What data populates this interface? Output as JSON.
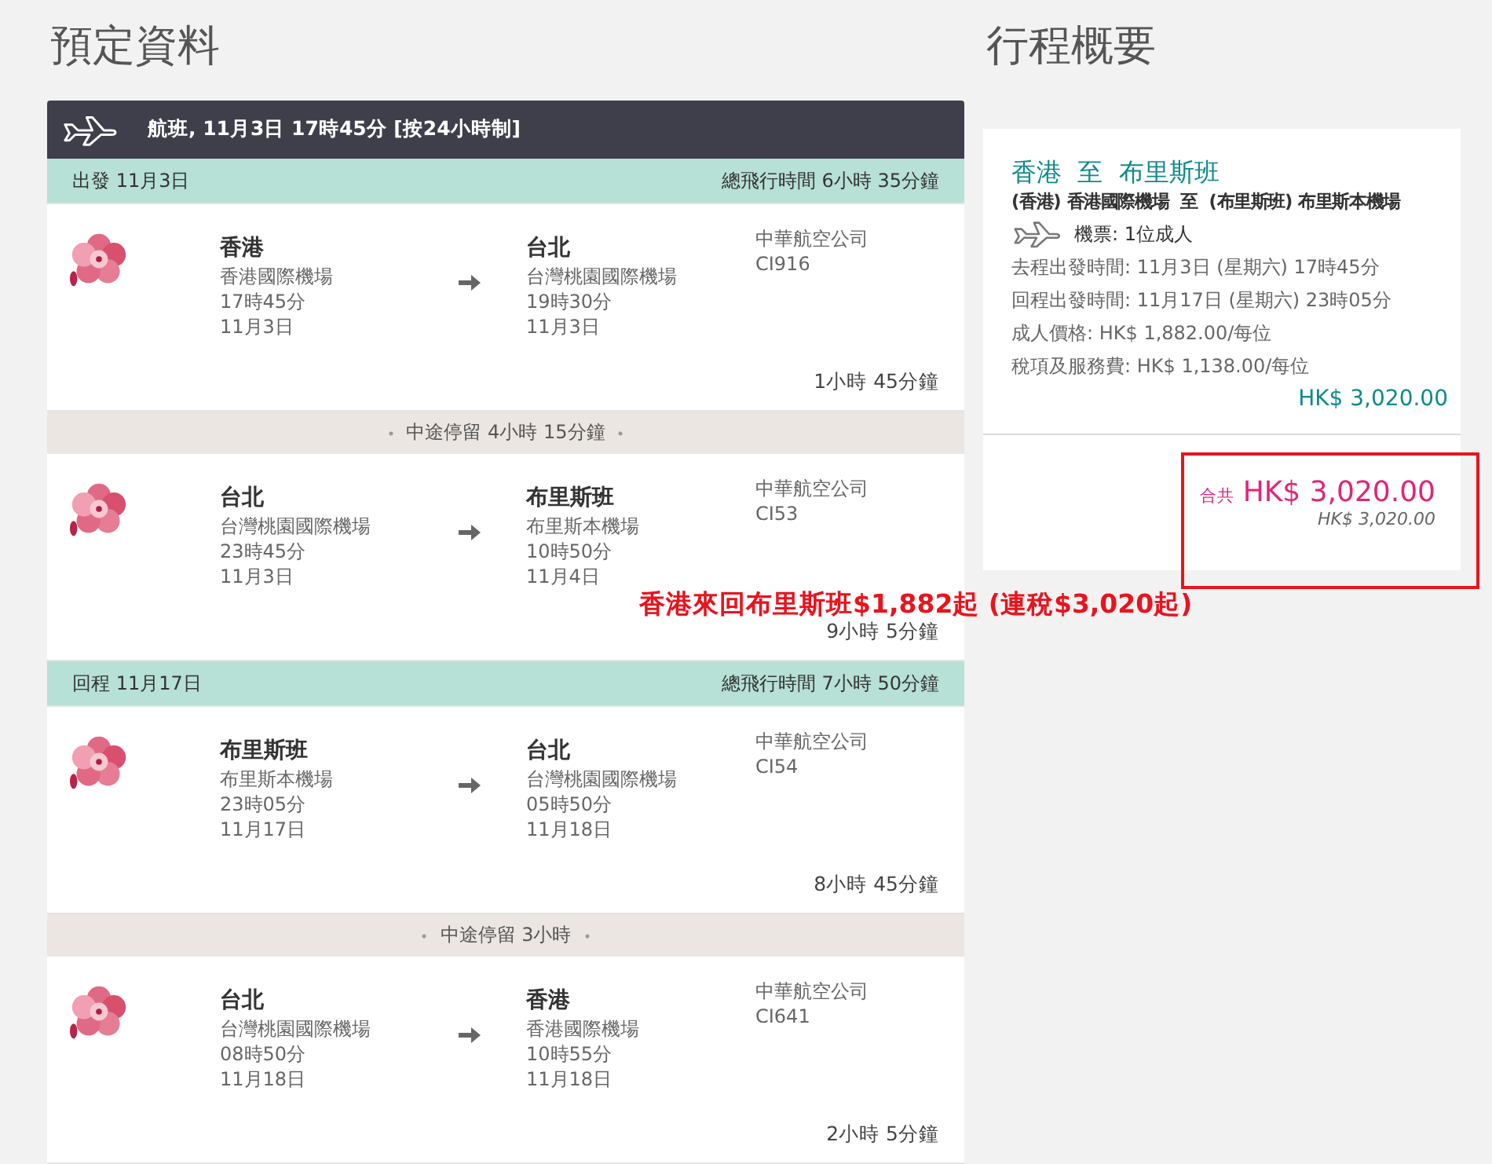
{
  "booking": {
    "title": "預定資料",
    "flight_header": "航班, 11月3日 17時45分 [按24小時制]",
    "sections": [
      {
        "kind": "leg",
        "label": "出發 11月3日",
        "total": "總飛行時間 6小時 35分鐘"
      },
      {
        "kind": "segment",
        "from_city": "香港",
        "from_airport": "香港國際機場",
        "from_time": "17時45分",
        "from_date": "11月3日",
        "to_city": "台北",
        "to_airport": "台灣桃園國際機場",
        "to_time": "19時30分",
        "to_date": "11月3日",
        "airline": "中華航空公司",
        "flight": "CI916",
        "duration": "1小時 45分鐘"
      },
      {
        "kind": "layover",
        "text": "中途停留 4小時 15分鐘"
      },
      {
        "kind": "segment",
        "from_city": "台北",
        "from_airport": "台灣桃園國際機場",
        "from_time": "23時45分",
        "from_date": "11月3日",
        "to_city": "布里斯班",
        "to_airport": "布里斯本機場",
        "to_time": "10時50分",
        "to_date": "11月4日",
        "airline": "中華航空公司",
        "flight": "CI53",
        "duration": "9小時 5分鐘"
      },
      {
        "kind": "leg",
        "label": "回程 11月17日",
        "total": "總飛行時間 7小時 50分鐘"
      },
      {
        "kind": "segment",
        "from_city": "布里斯班",
        "from_airport": "布里斯本機場",
        "from_time": "23時05分",
        "from_date": "11月17日",
        "to_city": "台北",
        "to_airport": "台灣桃園國際機場",
        "to_time": "05時50分",
        "to_date": "11月18日",
        "airline": "中華航空公司",
        "flight": "CI54",
        "duration": "8小時 45分鐘"
      },
      {
        "kind": "layover",
        "text": "中途停留 3小時"
      },
      {
        "kind": "segment",
        "from_city": "台北",
        "from_airport": "台灣桃園國際機場",
        "from_time": "08時50分",
        "from_date": "11月18日",
        "to_city": "香港",
        "to_airport": "香港國際機場",
        "to_time": "10時55分",
        "to_date": "11月18日",
        "airline": "中華航空公司",
        "flight": "CI641",
        "duration": "2小時 5分鐘"
      }
    ]
  },
  "summary": {
    "title": "行程概要",
    "route_title": "香港  至  布里斯班",
    "route_detail": "(香港) 香港國際機場  至  (布里斯班) 布里斯本機場",
    "tickets": "機票: 1位成人",
    "lines": [
      "去程出發時間: 11月3日 (星期六) 17時45分",
      "回程出發時間: 11月17日 (星期六) 23時05分",
      "成人價格: HK$ 1,882.00/每位",
      "稅項及服務費: HK$ 1,138.00/每位"
    ],
    "subtotal": "HK$ 3,020.00",
    "total_label": "合共",
    "total": "HK$ 3,020.00",
    "total_note": "HK$ 3,020.00"
  },
  "annotation": {
    "text": "香港來回布里斯班$1,882起 (連稅$3,020起)"
  }
}
